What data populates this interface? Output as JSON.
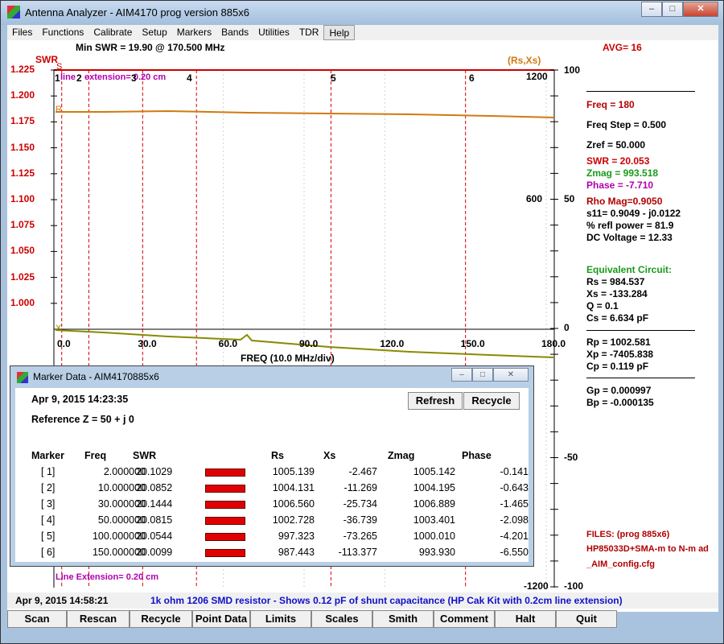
{
  "window": {
    "title": "Antenna Analyzer - AIM4170    prog version 885x6"
  },
  "menu": [
    "Files",
    "Functions",
    "Calibrate",
    "Setup",
    "Markers",
    "Bands",
    "Utilities",
    "TDR",
    "Help"
  ],
  "header": {
    "min_swr": "Min SWR =  19.90 @  170.500 MHz",
    "avg": "AVG=  16",
    "swr_label": "SWR",
    "rsxs_label": "(Rs,Xs)"
  },
  "plot": {
    "swr_ticks": [
      "1.225",
      "1.200",
      "1.175",
      "1.150",
      "1.125",
      "1.100",
      "1.075",
      "1.050",
      "1.025",
      "1.000"
    ],
    "right_outer_ticks": [
      "100",
      "50",
      "0",
      "-50",
      "-100"
    ],
    "right_inner_ticks": [
      "1200",
      "600",
      "-1200"
    ],
    "x_ticks": [
      "0.0",
      "30.0",
      "60.0",
      "90.0",
      "120.0",
      "150.0",
      "180.0"
    ],
    "x_label": "FREQ (10.0 MHz/div)",
    "marker_nums": [
      "1",
      "2",
      "3",
      "4",
      "5",
      "6"
    ],
    "line_ext_top": "extension= 0.20 cm",
    "line_ext_prefix": "line",
    "line_ext_bottom": "Line Extension= 0.20 cm",
    "curve_tags": {
      "s": "S",
      "r": "R",
      "x": "X"
    }
  },
  "side": {
    "freq": "Freq = 180",
    "freq_step": "Freq Step = 0.500",
    "zref": "Zref =   50.000",
    "swr": "SWR  =  20.053",
    "zmag": "Zmag = 993.518",
    "phase": "Phase =  -7.710",
    "rho": "Rho Mag=0.9050",
    "s11": "s11= 0.9049 - j0.0122",
    "refl": "% refl power = 81.9",
    "dc": "DC Voltage =  12.33",
    "eq_title": "Equivalent Circuit:",
    "rs": "Rs =  984.537",
    "xs": "Xs = -133.284",
    "q": "Q =  0.1",
    "cs": "Cs =    6.634  pF",
    "rp": "Rp = 1002.581",
    "xp": "Xp = -7405.838",
    "cp": "Cp =    0.119  pF",
    "gp": "Gp =  0.000997",
    "bp": "Bp = -0.000135",
    "files_title": "FILES:  (prog 885x6)",
    "file1": "HP85033D+SMA-m to N-m ad",
    "file2": "_AIM_config.cfg"
  },
  "status": {
    "date": "Apr 9, 2015  14:58:21",
    "comment": "1k ohm 1206 SMD resistor - Shows 0.12 pF of shunt capacitance (HP Cak Kit with 0.2cm line extension)"
  },
  "buttons": [
    "Scan",
    "Rescan",
    "Recycle",
    "Point Data",
    "Limits",
    "Scales",
    "Smith",
    "Comment",
    "Halt",
    "Quit"
  ],
  "dialog": {
    "title": "Marker Data -  AIM4170885x6",
    "date": "Apr 9, 2015  14:23:35",
    "refz": "Reference Z = 50  + j 0",
    "refresh": "Refresh",
    "recycle": "Recycle",
    "headers": [
      "Marker",
      "Freq",
      "SWR",
      "Rs",
      "Xs",
      "Zmag",
      "Phase"
    ],
    "rows": [
      {
        "m": "[  1]",
        "f": "2.000000",
        "swr": "20.1029",
        "rs": "1005.139",
        "xs": "-2.467",
        "zmag": "1005.142",
        "ph": "-0.141"
      },
      {
        "m": "[  2]",
        "f": "10.000000",
        "swr": "20.0852",
        "rs": "1004.131",
        "xs": "-11.269",
        "zmag": "1004.195",
        "ph": "-0.643"
      },
      {
        "m": "[  3]",
        "f": "30.000000",
        "swr": "20.1444",
        "rs": "1006.560",
        "xs": "-25.734",
        "zmag": "1006.889",
        "ph": "-1.465"
      },
      {
        "m": "[  4]",
        "f": "50.000000",
        "swr": "20.0815",
        "rs": "1002.728",
        "xs": "-36.739",
        "zmag": "1003.401",
        "ph": "-2.098"
      },
      {
        "m": "[  5]",
        "f": "100.000000",
        "swr": "20.0544",
        "rs": "997.323",
        "xs": "-73.265",
        "zmag": "1000.010",
        "ph": "-4.201"
      },
      {
        "m": "[  6]",
        "f": "150.000000",
        "swr": "20.0099",
        "rs": "987.443",
        "xs": "-113.377",
        "zmag": "993.930",
        "ph": "-6.550"
      }
    ]
  },
  "colors": {
    "swr": "#cc0000",
    "rs": "#d07a10",
    "xs": "#8a8a00",
    "marker": "#dd0000",
    "grid": "#d0d0d0"
  }
}
